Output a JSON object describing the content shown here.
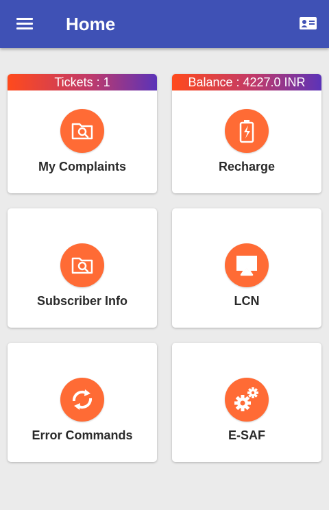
{
  "appbar": {
    "title": "Home",
    "menu_icon": "hamburger-menu-icon",
    "profile_icon": "id-card-icon",
    "color": "#3f51b5"
  },
  "tiles": [
    {
      "label": "My Complaints",
      "banner": "Tickets : 1",
      "icon": "folder-search-icon"
    },
    {
      "label": "Recharge",
      "banner": "Balance : 4227.0 INR",
      "icon": "battery-charging-icon"
    },
    {
      "label": "Subscriber Info",
      "icon": "folder-search-icon"
    },
    {
      "label": "LCN",
      "icon": "cast-screen-icon"
    },
    {
      "label": "Error Commands",
      "icon": "refresh-arrows-icon"
    },
    {
      "label": "E-SAF",
      "icon": "gears-icon"
    }
  ],
  "colors": {
    "accent": "#ff6b35",
    "banner_start": "#ff4a1c",
    "banner_end": "#5b33b8",
    "background": "#ebebeb"
  }
}
